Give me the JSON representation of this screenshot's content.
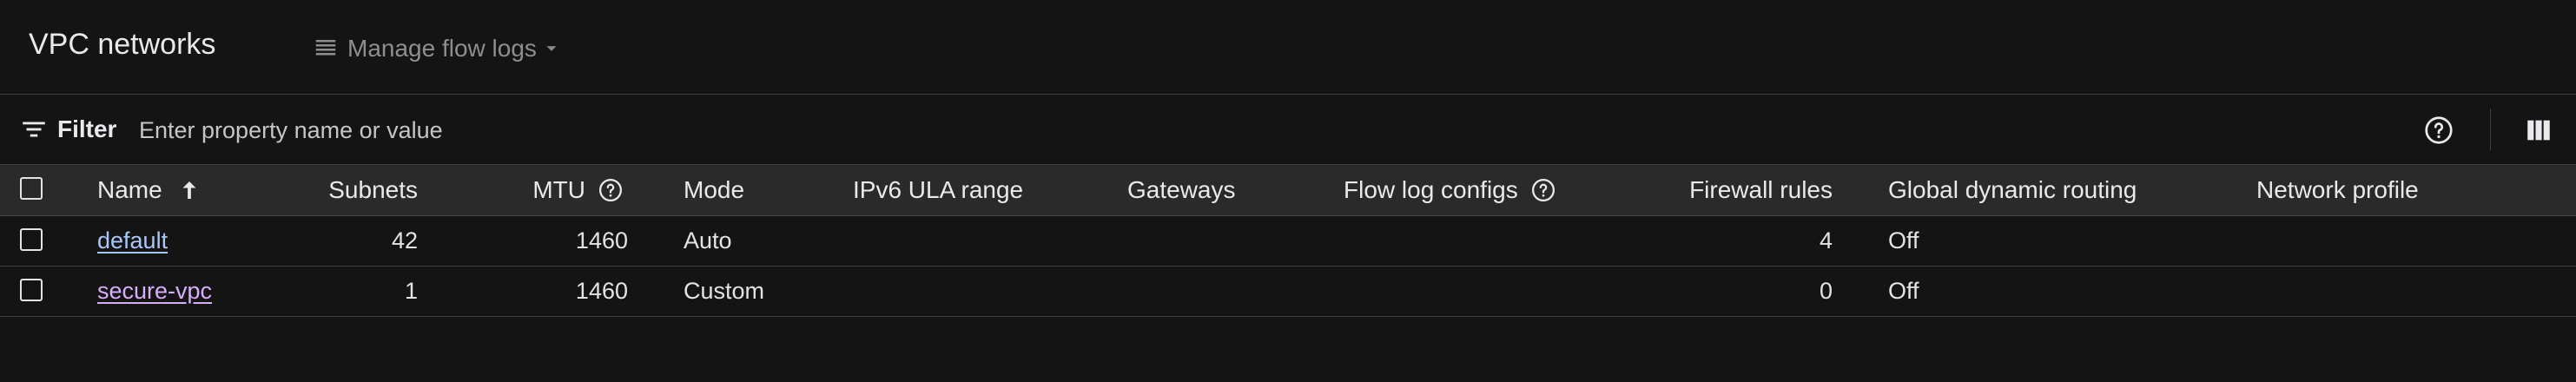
{
  "header": {
    "title": "VPC networks",
    "manage_flow_logs_label": "Manage flow logs"
  },
  "filter": {
    "label": "Filter",
    "placeholder": "Enter property name or value"
  },
  "table": {
    "columns": {
      "name": "Name",
      "subnets": "Subnets",
      "mtu": "MTU",
      "mode": "Mode",
      "ipv6": "IPv6 ULA range",
      "gateways": "Gateways",
      "flow_log_configs": "Flow log configs",
      "firewall_rules": "Firewall rules",
      "global_dynamic_routing": "Global dynamic routing",
      "network_profile": "Network profile"
    },
    "sort": {
      "column": "name",
      "direction": "ascending"
    },
    "rows": [
      {
        "name": "default",
        "subnets": "42",
        "mtu": "1460",
        "mode": "Auto",
        "ipv6": "",
        "gateways": "",
        "flow_log_configs": "",
        "firewall_rules": "4",
        "global_dynamic_routing": "Off",
        "network_profile": ""
      },
      {
        "name": "secure-vpc",
        "subnets": "1",
        "mtu": "1460",
        "mode": "Custom",
        "ipv6": "",
        "gateways": "",
        "flow_log_configs": "",
        "firewall_rules": "0",
        "global_dynamic_routing": "Off",
        "network_profile": ""
      }
    ]
  },
  "icons": {
    "manage_flow_logs": "list-icon",
    "manage_flow_logs_caret": "caret-down-icon",
    "filter": "filter-icon",
    "help": "help-icon",
    "columns": "column-display-icon",
    "sort": "arrow-up-icon",
    "column_help": "help-icon"
  },
  "colors": {
    "background": "#141414",
    "header_row": "#2a2a2a",
    "link": "#a8c7fa",
    "visited_link": "#d7aefb",
    "muted_text": "#8e8e8e"
  }
}
